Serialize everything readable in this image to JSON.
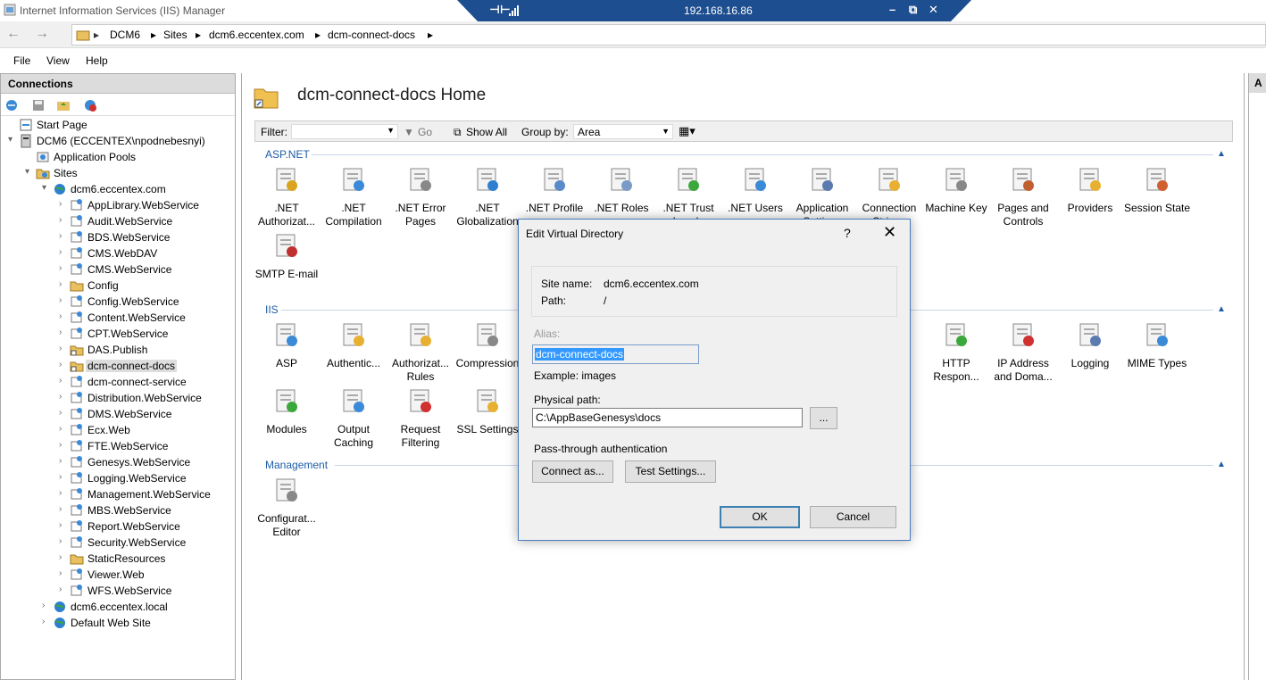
{
  "window": {
    "title": "Internet Information Services (IIS) Manager"
  },
  "rdp": {
    "host": "192.168.16.86",
    "pin": "⊣⊢",
    "minimize": "–",
    "restore": "⧉",
    "close": "✕"
  },
  "breadcrumb": [
    "DCM6",
    "Sites",
    "dcm6.eccentex.com",
    "dcm-connect-docs"
  ],
  "menu": [
    "File",
    "View",
    "Help"
  ],
  "connections": {
    "header": "Connections",
    "tree": [
      {
        "label": "Start Page",
        "indent": 0,
        "icon": "start-page-icon",
        "exp": ""
      },
      {
        "label": "DCM6 (ECCENTEX\\npodnebesnyi)",
        "indent": 0,
        "icon": "server-icon",
        "exp": "▾"
      },
      {
        "label": "Application Pools",
        "indent": 1,
        "icon": "app-pools-icon",
        "exp": ""
      },
      {
        "label": "Sites",
        "indent": 1,
        "icon": "sites-folder-icon",
        "exp": "▾"
      },
      {
        "label": "dcm6.eccentex.com",
        "indent": 2,
        "icon": "globe-icon",
        "exp": "▾"
      },
      {
        "label": "AppLibrary.WebService",
        "indent": 3,
        "icon": "web-app-icon",
        "exp": "›"
      },
      {
        "label": "Audit.WebService",
        "indent": 3,
        "icon": "web-app-icon",
        "exp": "›"
      },
      {
        "label": "BDS.WebService",
        "indent": 3,
        "icon": "web-app-icon",
        "exp": "›"
      },
      {
        "label": "CMS.WebDAV",
        "indent": 3,
        "icon": "web-app-icon",
        "exp": "›"
      },
      {
        "label": "CMS.WebService",
        "indent": 3,
        "icon": "web-app-icon",
        "exp": "›"
      },
      {
        "label": "Config",
        "indent": 3,
        "icon": "folder-icon",
        "exp": "›"
      },
      {
        "label": "Config.WebService",
        "indent": 3,
        "icon": "web-app-icon",
        "exp": "›"
      },
      {
        "label": "Content.WebService",
        "indent": 3,
        "icon": "web-app-icon",
        "exp": "›"
      },
      {
        "label": "CPT.WebService",
        "indent": 3,
        "icon": "web-app-icon",
        "exp": "›"
      },
      {
        "label": "DAS.Publish",
        "indent": 3,
        "icon": "virtual-dir-icon",
        "exp": "›"
      },
      {
        "label": "dcm-connect-docs",
        "indent": 3,
        "icon": "virtual-dir-icon",
        "exp": "›",
        "selected": true
      },
      {
        "label": "dcm-connect-service",
        "indent": 3,
        "icon": "web-app-icon",
        "exp": "›"
      },
      {
        "label": "Distribution.WebService",
        "indent": 3,
        "icon": "web-app-icon",
        "exp": "›"
      },
      {
        "label": "DMS.WebService",
        "indent": 3,
        "icon": "web-app-icon",
        "exp": "›"
      },
      {
        "label": "Ecx.Web",
        "indent": 3,
        "icon": "web-app-icon",
        "exp": "›"
      },
      {
        "label": "FTE.WebService",
        "indent": 3,
        "icon": "web-app-icon",
        "exp": "›"
      },
      {
        "label": "Genesys.WebService",
        "indent": 3,
        "icon": "web-app-icon",
        "exp": "›"
      },
      {
        "label": "Logging.WebService",
        "indent": 3,
        "icon": "web-app-icon",
        "exp": "›"
      },
      {
        "label": "Management.WebService",
        "indent": 3,
        "icon": "web-app-icon",
        "exp": "›"
      },
      {
        "label": "MBS.WebService",
        "indent": 3,
        "icon": "web-app-icon",
        "exp": "›"
      },
      {
        "label": "Report.WebService",
        "indent": 3,
        "icon": "web-app-icon",
        "exp": "›"
      },
      {
        "label": "Security.WebService",
        "indent": 3,
        "icon": "web-app-icon",
        "exp": "›"
      },
      {
        "label": "StaticResources",
        "indent": 3,
        "icon": "folder-icon",
        "exp": "›"
      },
      {
        "label": "Viewer.Web",
        "indent": 3,
        "icon": "web-app-icon",
        "exp": "›"
      },
      {
        "label": "WFS.WebService",
        "indent": 3,
        "icon": "web-app-icon",
        "exp": "›"
      },
      {
        "label": "dcm6.eccentex.local",
        "indent": 2,
        "icon": "globe-icon",
        "exp": "›"
      },
      {
        "label": "Default Web Site",
        "indent": 2,
        "icon": "globe-icon",
        "exp": "›"
      }
    ]
  },
  "main": {
    "title": "dcm-connect-docs Home",
    "filter": {
      "label": "Filter:",
      "go": "Go",
      "show_all": "Show All",
      "group_by": "Group by:",
      "group_value": "Area"
    },
    "sections": {
      "aspnet": "ASP.NET",
      "iis": "IIS",
      "management": "Management"
    },
    "aspnet_tiles": [
      ".NET Authorizat...",
      ".NET Compilation",
      ".NET Error Pages",
      ".NET Globalization",
      ".NET Profile",
      ".NET Roles",
      ".NET Trust Levels",
      ".NET Users",
      "Application Settings",
      "Connection Strings",
      "Machine Key",
      "Pages and Controls",
      "Providers",
      "Session State",
      "SMTP E-mail"
    ],
    "iis_tiles": [
      "ASP",
      "Authentic...",
      "Authorizat... Rules",
      "Compression",
      "HTTP Respon...",
      "IP Address and Doma...",
      "Logging",
      "MIME Types",
      "Modules",
      "Output Caching",
      "Request Filtering",
      "SSL Settings"
    ],
    "management_tiles": [
      "Configurat... Editor"
    ]
  },
  "dialog": {
    "title": "Edit Virtual Directory",
    "help": "?",
    "close": "✕",
    "site_name_label": "Site name:",
    "site_name_value": "dcm6.eccentex.com",
    "path_label": "Path:",
    "path_value": "/",
    "alias_label": "Alias:",
    "alias_value": "dcm-connect-docs",
    "example": "Example: images",
    "physical_path_label": "Physical path:",
    "physical_path_value": "C:\\AppBaseGenesys\\docs",
    "browse": "...",
    "passthrough_label": "Pass-through authentication",
    "connect_as": "Connect as...",
    "test_settings": "Test Settings...",
    "ok": "OK",
    "cancel": "Cancel"
  },
  "colors": {
    "accent": "#1d5ca6",
    "rdp_bar": "#1d4e8f",
    "selection": "#3399ff"
  }
}
